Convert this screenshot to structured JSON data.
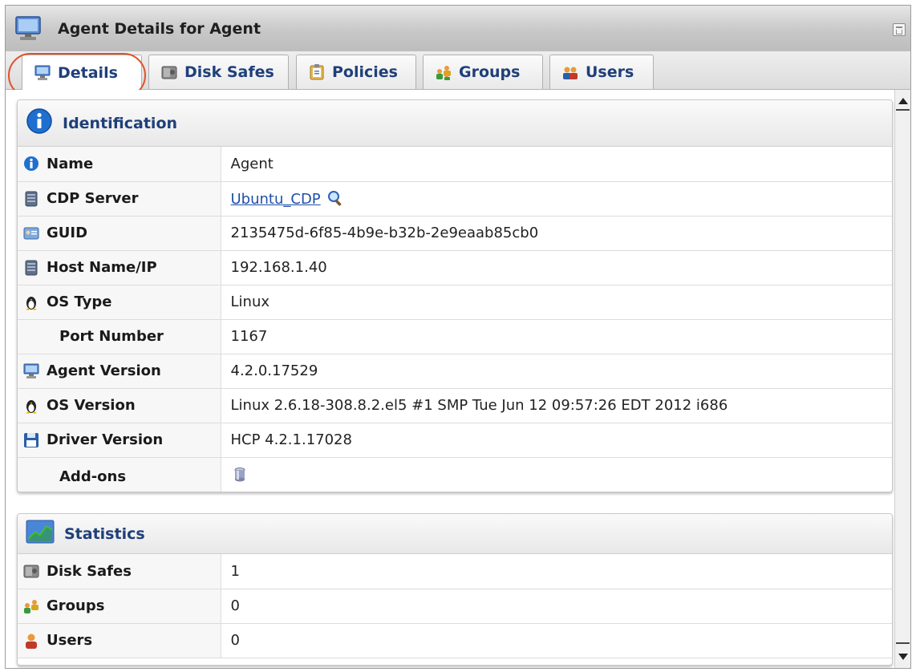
{
  "window": {
    "title": "Agent Details for Agent"
  },
  "tabs": [
    {
      "label": "Details",
      "active": true
    },
    {
      "label": "Disk Safes",
      "active": false
    },
    {
      "label": "Policies",
      "active": false
    },
    {
      "label": "Groups",
      "active": false
    },
    {
      "label": "Users",
      "active": false
    }
  ],
  "identification": {
    "header": "Identification",
    "rows": {
      "name": {
        "label": "Name",
        "value": "Agent",
        "icon": "info-icon"
      },
      "cdp_server": {
        "label": "CDP Server",
        "value": "Ubuntu_CDP",
        "icon": "server-icon"
      },
      "guid": {
        "label": "GUID",
        "value": "2135475d-6f85-4b9e-b32b-2e9eaab85cb0",
        "icon": "id-card-icon"
      },
      "host": {
        "label": "Host Name/IP",
        "value": "192.168.1.40",
        "icon": "server-icon"
      },
      "os_type": {
        "label": "OS Type",
        "value": "Linux",
        "icon": "linux-penguin-icon"
      },
      "port": {
        "label": "Port Number",
        "value": "1167"
      },
      "agent_version": {
        "label": "Agent Version",
        "value": "4.2.0.17529",
        "icon": "monitor-icon"
      },
      "os_version": {
        "label": "OS Version",
        "value": "Linux 2.6.18-308.8.2.el5 #1 SMP Tue Jun 12 09:57:26 EDT 2012 i686",
        "icon": "linux-penguin-icon"
      },
      "driver_version": {
        "label": "Driver Version",
        "value": "HCP 4.2.1.17028",
        "icon": "floppy-disk-icon"
      },
      "addons": {
        "label": "Add-ons",
        "icon": "database-addon-icon"
      }
    }
  },
  "statistics": {
    "header": "Statistics",
    "rows": {
      "disk_safes": {
        "label": "Disk Safes",
        "value": "1",
        "icon": "disk-safe-icon"
      },
      "groups": {
        "label": "Groups",
        "value": "0",
        "icon": "groups-icon"
      },
      "users": {
        "label": "Users",
        "value": "0",
        "icon": "user-icon"
      }
    }
  },
  "colors": {
    "link": "#1f4fa8",
    "header_text": "#1f3f7a",
    "highlight": "#e0522a"
  }
}
